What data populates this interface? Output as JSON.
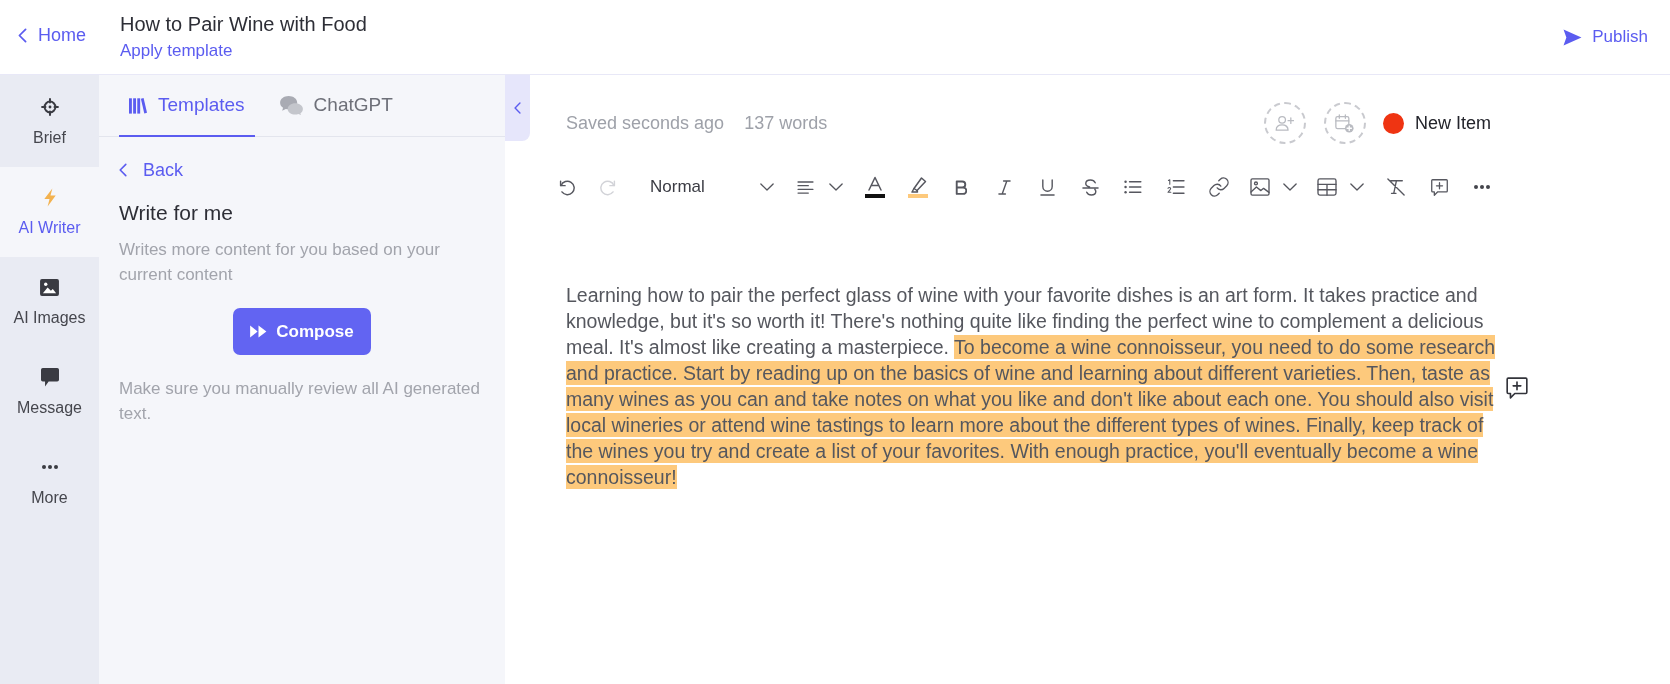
{
  "header": {
    "home_link": "Home",
    "title": "How to Pair Wine with Food",
    "template_link": "Apply template",
    "publish_button": "Publish"
  },
  "side_rail": [
    {
      "label": "Brief",
      "selected": false
    },
    {
      "label": "AI Writer",
      "selected": true
    },
    {
      "label": "AI Images",
      "selected": false
    },
    {
      "label": "Message",
      "selected": false
    },
    {
      "label": "More",
      "selected": false
    }
  ],
  "side_panel": {
    "tabs": [
      {
        "label": "Templates",
        "selected": true
      },
      {
        "label": "ChatGPT",
        "selected": false
      }
    ],
    "back_link": "Back",
    "heading": "Write for me",
    "description": "Writes more content for you based on your current content",
    "compose_button": "Compose",
    "note": "Make sure you manually review all AI generated text."
  },
  "editor": {
    "save_status": "Saved seconds ago",
    "word_count": "137 words",
    "status": {
      "label": "New Item",
      "color": "#ef3412"
    },
    "toolbar": {
      "history": [
        {
          "disabled": false
        },
        {
          "disabled": true
        }
      ],
      "text_style": "Normal"
    },
    "paragraph": [
      {
        "text": "Learning how to pair the perfect glass of wine with your favorite dishes is an art form. It takes practice and knowledge, but it's so worth it! There's nothing quite like finding the perfect wine to complement a delicious meal. It's almost like creating a masterpiece. ",
        "highlighted": false
      },
      {
        "text": "To become a wine connoisseur, you need to do some research and practice. Start by reading up on the basics of wine and learning about different varieties. Then, taste as many wines as you can and take notes on what you like and don't like about each one. You should also visit local wineries or attend wine tastings to learn more about the different types of wines. Finally, keep track of the wines you try and create a list of your favorites. With enough practice, you'll eventually become a wine connoisseur!",
        "highlighted": true
      }
    ]
  }
}
